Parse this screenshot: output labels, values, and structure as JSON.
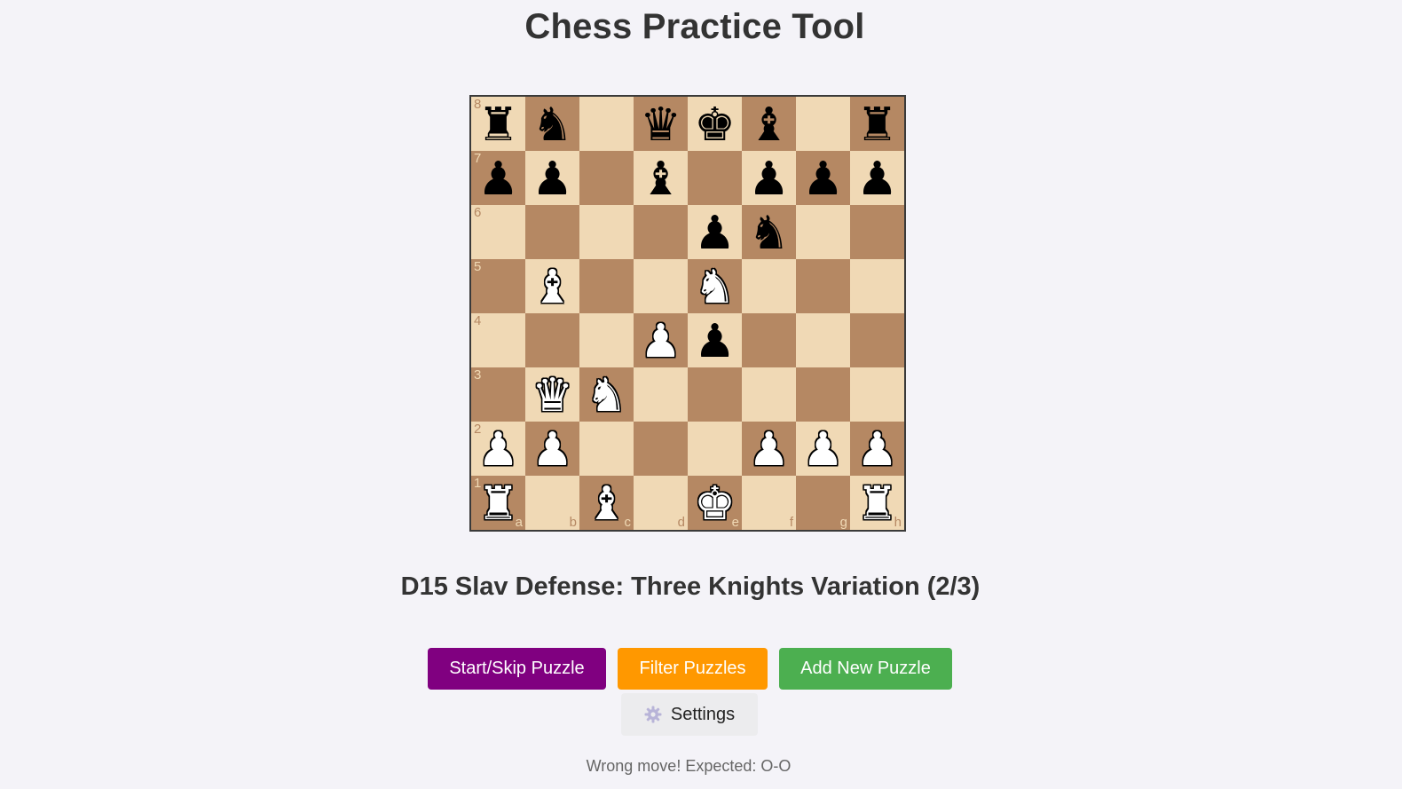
{
  "header": {
    "title": "Chess Practice Tool"
  },
  "board": {
    "files": [
      "a",
      "b",
      "c",
      "d",
      "e",
      "f",
      "g",
      "h"
    ],
    "ranks": [
      "8",
      "7",
      "6",
      "5",
      "4",
      "3",
      "2",
      "1"
    ],
    "position": [
      [
        "r",
        "n",
        "",
        "q",
        "k",
        "b",
        "",
        "r"
      ],
      [
        "p",
        "p",
        "",
        "b",
        "",
        "p",
        "p",
        "p"
      ],
      [
        "",
        "",
        "",
        "",
        "p",
        "n",
        "",
        ""
      ],
      [
        "",
        "B",
        "",
        "",
        "N",
        "",
        "",
        ""
      ],
      [
        "",
        "",
        "",
        "P",
        "p",
        "",
        "",
        ""
      ],
      [
        "",
        "Q",
        "N",
        "",
        "",
        "",
        "",
        ""
      ],
      [
        "P",
        "P",
        "",
        "",
        "",
        "P",
        "P",
        "P"
      ],
      [
        "R",
        "",
        "B",
        "",
        "K",
        "",
        "",
        "R"
      ]
    ],
    "colors": {
      "light_square": "#f0d9b5",
      "dark_square": "#b58863"
    }
  },
  "puzzle": {
    "opening_label": "D15 Slav Defense: Three Knights Variation (2/3)"
  },
  "controls": {
    "start_skip_label": "Start/Skip Puzzle",
    "filter_label": "Filter Puzzles",
    "add_label": "Add New Puzzle",
    "settings_label": "Settings",
    "settings_icon": "gear-icon"
  },
  "colors": {
    "start_skip": "#800080",
    "filter": "#ff9800",
    "add": "#4caf50"
  },
  "status": {
    "message": "Wrong move! Expected: O-O"
  }
}
